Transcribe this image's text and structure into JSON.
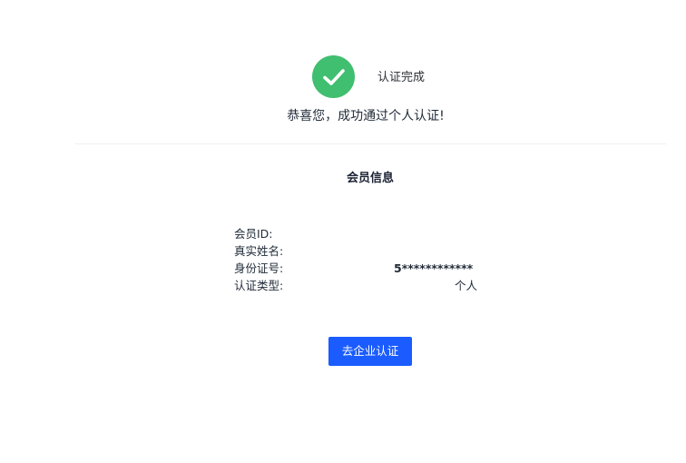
{
  "status": {
    "title": "认证完成",
    "message": "恭喜您，成功通过个人认证!",
    "icon": "check-circle-icon",
    "icon_color": "#3fbf6f"
  },
  "member_info": {
    "section_title": "会员信息",
    "fields": [
      {
        "label": "会员ID:",
        "value": ""
      },
      {
        "label": "真实姓名:",
        "value": ""
      },
      {
        "label": "身份证号:",
        "value": "5************"
      },
      {
        "label": "认证类型:",
        "value": "个人"
      }
    ]
  },
  "actions": {
    "enterprise_label": "去企业认证",
    "button_color": "#1a5cff"
  }
}
